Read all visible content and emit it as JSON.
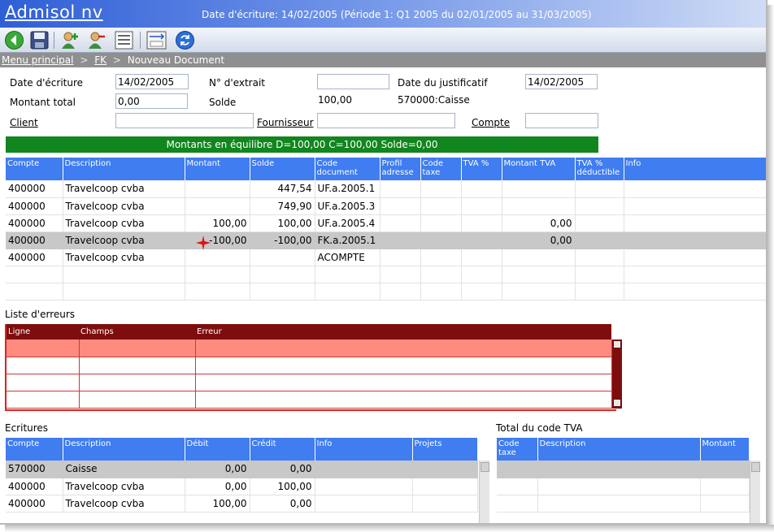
{
  "app": {
    "title": "Admisol nv",
    "header_info": "Date d'écriture: 14/02/2005 (Période 1: Q1 2005 du 02/01/2005 au 31/03/2005)"
  },
  "toolbar": {
    "icons": [
      "back-arrow-icon",
      "save-disk-icon",
      "add-user-icon",
      "remove-user-icon",
      "numbered-list-icon",
      "numbering-icon",
      "refresh-icon"
    ]
  },
  "breadcrumb": {
    "home": "Menu principal",
    "sep1": ">",
    "section": "FK",
    "sep2": ">",
    "current": "Nouveau Document"
  },
  "form": {
    "date_ecriture_label": "Date d'écriture",
    "date_ecriture_value": "14/02/2005",
    "extrait_label": "N° d'extrait",
    "extrait_value": "",
    "date_justif_label": "Date du justificatif",
    "date_justif_value": "14/02/2005",
    "montant_total_label": "Montant total",
    "montant_total_value": "0,00",
    "solde_label": "Solde",
    "solde_value": "100,00",
    "caisse_value": "570000:Caisse",
    "client_label": "Client",
    "client_value": "",
    "fournisseur_label": "Fournisseur",
    "fournisseur_value": "",
    "compte_label": "Compte",
    "compte_value": ""
  },
  "balance": {
    "text": "Montants en équilibre D=100,00 C=100,00 Solde=0,00",
    "color": "#11851e"
  },
  "lines": {
    "headers": [
      "Compte",
      "Description",
      "Montant",
      "Solde",
      "Code document",
      "Profil adresse",
      "Code taxe",
      "TVA %",
      "Montant TVA",
      "TVA % déductible",
      "Info"
    ],
    "rows": [
      [
        "400000",
        "Travelcoop cvba",
        "",
        "447,54",
        "UF.a.2005.1",
        "",
        "",
        "",
        "",
        "",
        ""
      ],
      [
        "400000",
        "Travelcoop cvba",
        "",
        "749,90",
        "UF.a.2005.3",
        "",
        "",
        "",
        "",
        "",
        ""
      ],
      [
        "400000",
        "Travelcoop cvba",
        "100,00",
        "100,00",
        "UF.a.2005.4",
        "",
        "",
        "",
        "0,00",
        "",
        ""
      ],
      [
        "400000",
        "Travelcoop cvba",
        "-100,00",
        "-100,00",
        "FK.a.2005.1",
        "",
        "",
        "",
        "0,00",
        "",
        ""
      ],
      [
        "400000",
        "Travelcoop cvba",
        "",
        "",
        "ACOMPTE",
        "",
        "",
        "",
        "",
        "",
        ""
      ],
      [
        "",
        "",
        "",
        "",
        "",
        "",
        "",
        "",
        "",
        "",
        ""
      ],
      [
        "",
        "",
        "",
        "",
        "",
        "",
        "",
        "",
        "",
        "",
        ""
      ]
    ]
  },
  "errors": {
    "title": "Liste d'erreurs",
    "headers": [
      "Ligne",
      "Champs",
      "Erreur"
    ],
    "rows": [
      [
        "",
        "",
        ""
      ],
      [
        "",
        "",
        ""
      ],
      [
        "",
        "",
        ""
      ],
      [
        "",
        "",
        ""
      ]
    ]
  },
  "ecritures": {
    "title": "Ecritures",
    "headers": [
      "Compte",
      "Description",
      "Débit",
      "Crédit",
      "Info",
      "Projets"
    ],
    "rows": [
      [
        "570000",
        "Caisse",
        "0,00",
        "0,00",
        "",
        ""
      ],
      [
        "400000",
        "Travelcoop cvba",
        "0,00",
        "100,00",
        "",
        ""
      ],
      [
        "400000",
        "Travelcoop cvba",
        "100,00",
        "0,00",
        "",
        ""
      ]
    ]
  },
  "tva": {
    "title": "Total du code TVA",
    "headers": [
      "Code taxe",
      "Description",
      "Montant"
    ],
    "rows": [
      [
        "",
        "",
        ""
      ],
      [
        "",
        "",
        ""
      ],
      [
        "",
        "",
        ""
      ]
    ]
  }
}
